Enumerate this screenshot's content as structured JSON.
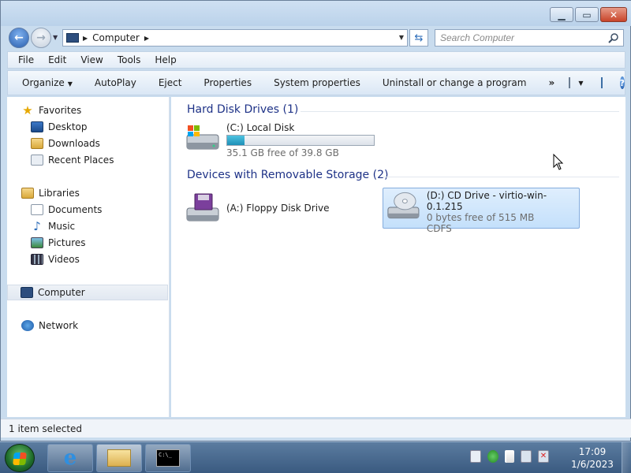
{
  "window": {
    "minimize_glyph": "▁",
    "maximize_glyph": "▭",
    "close_glyph": "✕"
  },
  "address": {
    "location": "Computer",
    "search_placeholder": "Search Computer"
  },
  "menu": [
    "File",
    "Edit",
    "View",
    "Tools",
    "Help"
  ],
  "commands": {
    "organize": "Organize",
    "autoplay": "AutoPlay",
    "eject": "Eject",
    "properties": "Properties",
    "system_properties": "System properties",
    "uninstall": "Uninstall or change a program",
    "more": "»"
  },
  "nav": {
    "favorites": "Favorites",
    "desktop": "Desktop",
    "downloads": "Downloads",
    "recent": "Recent Places",
    "libraries": "Libraries",
    "documents": "Documents",
    "music": "Music",
    "pictures": "Pictures",
    "videos": "Videos",
    "computer": "Computer",
    "network": "Network"
  },
  "groups": {
    "hdd": "Hard Disk Drives (1)",
    "removable": "Devices with Removable Storage (2)"
  },
  "drives": {
    "c": {
      "name": "(C:) Local Disk",
      "free": "35.1 GB free of 39.8 GB",
      "used_fraction": 0.12
    },
    "a": {
      "name": "(A:) Floppy Disk Drive"
    },
    "d": {
      "name": "(D:) CD Drive - virtio-win-0.1.215",
      "free": "0 bytes free of 515 MB",
      "fs": "CDFS"
    }
  },
  "status": "1 item selected",
  "clock": {
    "time": "17:09",
    "date": "1/6/2023"
  }
}
